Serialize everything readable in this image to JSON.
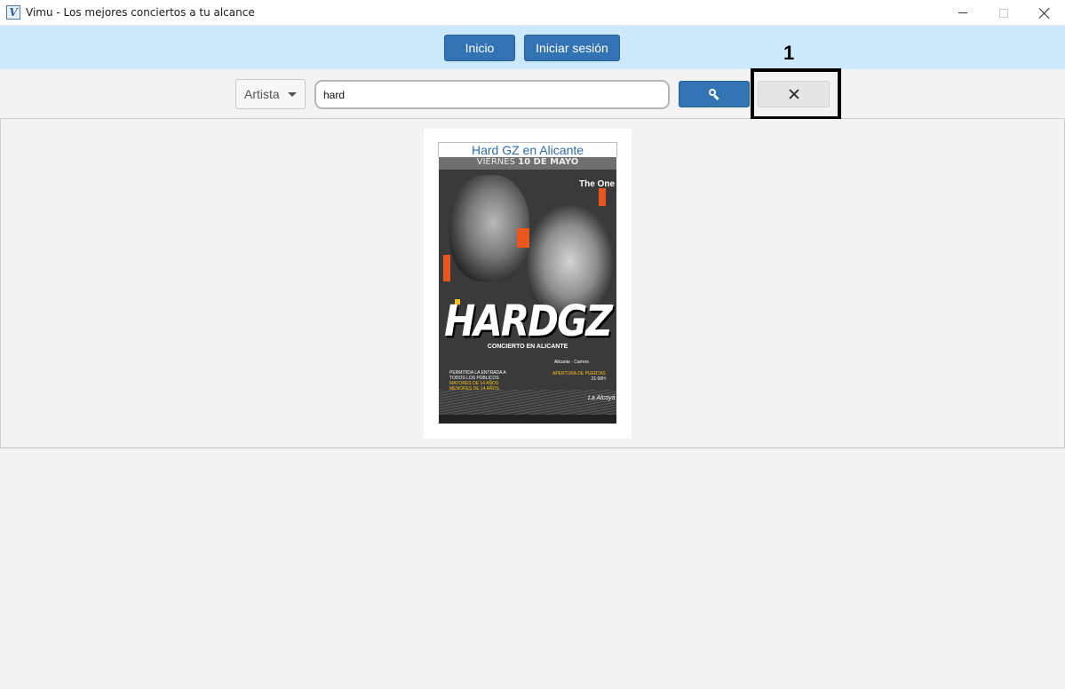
{
  "window": {
    "title": "Vimu - Los mejores conciertos a tu alcance",
    "icon_letter": "V"
  },
  "nav": {
    "inicio_label": "Inicio",
    "login_label": "Iniciar sesión"
  },
  "search": {
    "filter_selected": "Artista",
    "query": "hard",
    "search_icon": "search-icon",
    "clear_icon": "close-icon"
  },
  "annotation": {
    "label": "1"
  },
  "results": [
    {
      "title": "Hard GZ en Alicante",
      "poster": {
        "date_prefix": "VIERNES",
        "date_bold": "10 DE MAYO",
        "brand": "The One",
        "artist": "HARDGZ",
        "subtitle": "CONCIERTO EN ALICANTE",
        "info_line1": "PERMITIDA LA ENTRADA A",
        "info_line2": "TODOS LOS PÚBLICOS",
        "info_line3": "MAYORES DE 14 AÑOS",
        "info_line4": "MENORES DE 14 AÑOS",
        "apertura": "APERTURA DE PUERTAS",
        "hora": "21:00H",
        "sponsor": "Alicante · Carrers",
        "signature": "La Alcoyá"
      }
    }
  ],
  "colors": {
    "nav_bg": "#cce9fb",
    "primary_button": "#3273b4",
    "card_title": "#2e6da4"
  }
}
